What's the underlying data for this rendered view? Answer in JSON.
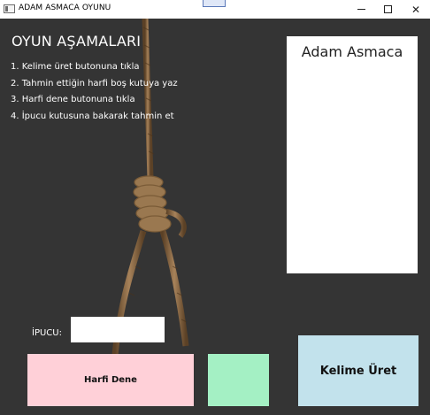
{
  "window": {
    "title": "ADAM ASMACA OYUNU",
    "controls": {
      "minimize_icon": "minimize-icon",
      "maximize_icon": "maximize-icon",
      "close_icon": "close-icon"
    }
  },
  "instructions": {
    "heading": "OYUN AŞAMALARI",
    "steps": [
      "1. Kelime üret butonuna tıkla",
      "2. Tahmin ettiğin harfi boş kutuya yaz",
      "3. Harfi dene butonuna tıkla",
      "4. İpucu kutusuna bakarak tahmin et"
    ]
  },
  "panel": {
    "title": "Adam Asmaca"
  },
  "hint": {
    "label": "İPUCU:",
    "value": ""
  },
  "letter_input": {
    "value": ""
  },
  "buttons": {
    "try_letter": "Harfi Dene",
    "generate_word": "Kelime Üret"
  },
  "colors": {
    "background": "#343434",
    "try_button": "#ffd0d8",
    "letter_box": "#a4f0c4",
    "generate_button": "#c2e2ec",
    "rope": "#8a6a42"
  }
}
